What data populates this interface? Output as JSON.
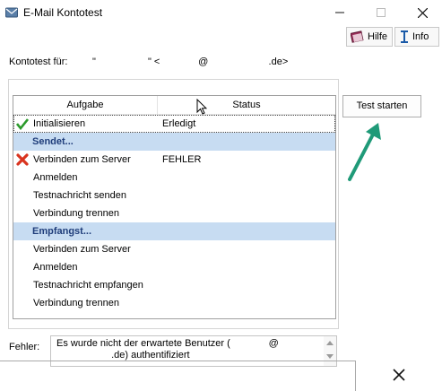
{
  "window": {
    "title": "E-Mail Kontotest",
    "title_icon": "mail-icon",
    "controls": [
      "minimize-icon",
      "maximize-icon",
      "close-icon"
    ]
  },
  "toolbar": {
    "hilfe_label": "Hilfe",
    "hilfe_icon": "book-icon",
    "info_label": "Info",
    "info_icon": "info-icon"
  },
  "konto": {
    "label": "Kontotest für:",
    "value": "\"                   \" <              @                      .de>"
  },
  "table": {
    "columns": [
      "Aufgabe",
      "Status"
    ],
    "rows": [
      {
        "task": "Initialisieren",
        "status": "Erledigt",
        "icon": "check-icon",
        "type": "item"
      },
      {
        "task": "Sendet...",
        "status": "",
        "icon": "",
        "type": "section"
      },
      {
        "task": "Verbinden zum Server",
        "status": "FEHLER",
        "icon": "error-x-icon",
        "type": "item"
      },
      {
        "task": "Anmelden",
        "status": "",
        "icon": "",
        "type": "item"
      },
      {
        "task": "Testnachricht senden",
        "status": "",
        "icon": "",
        "type": "item"
      },
      {
        "task": "Verbindung trennen",
        "status": "",
        "icon": "",
        "type": "item"
      },
      {
        "task": "Empfangst...",
        "status": "",
        "icon": "",
        "type": "section"
      },
      {
        "task": "Verbinden zum Server",
        "status": "",
        "icon": "",
        "type": "item"
      },
      {
        "task": "Anmelden",
        "status": "",
        "icon": "",
        "type": "item"
      },
      {
        "task": "Testnachricht empfangen",
        "status": "",
        "icon": "",
        "type": "item"
      },
      {
        "task": "Verbindung trennen",
        "status": "",
        "icon": "",
        "type": "item"
      }
    ]
  },
  "actions": {
    "start_label": "Test starten"
  },
  "error": {
    "label": "Fehler:",
    "text": "Es wurde nicht der erwartete Benutzer (              @\n                    .de) authentifiziert"
  },
  "colors": {
    "section_bg": "#c7dcf2",
    "section_text": "#1f3d7a",
    "arrow": "#1f9a78",
    "error_red": "#d9341f",
    "check_green": "#2b9a2b"
  }
}
